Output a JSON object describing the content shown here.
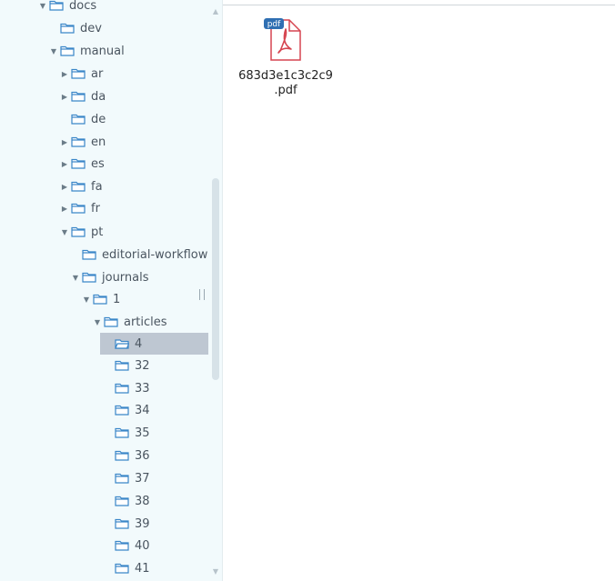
{
  "tree": {
    "items": [
      {
        "label": "docs",
        "expanded": true,
        "has_children": true
      },
      {
        "label": "dev",
        "expanded": false,
        "has_children": false
      },
      {
        "label": "manual",
        "expanded": true,
        "has_children": true
      },
      {
        "label": "ar",
        "expanded": false,
        "has_children": true
      },
      {
        "label": "da",
        "expanded": false,
        "has_children": true
      },
      {
        "label": "de",
        "expanded": false,
        "has_children": false
      },
      {
        "label": "en",
        "expanded": false,
        "has_children": true
      },
      {
        "label": "es",
        "expanded": false,
        "has_children": true
      },
      {
        "label": "fa",
        "expanded": false,
        "has_children": true
      },
      {
        "label": "fr",
        "expanded": false,
        "has_children": true
      },
      {
        "label": "pt",
        "expanded": true,
        "has_children": true
      },
      {
        "label": "editorial-workflow",
        "expanded": false,
        "has_children": false
      },
      {
        "label": "journals",
        "expanded": true,
        "has_children": true
      },
      {
        "label": "1",
        "expanded": true,
        "has_children": true
      },
      {
        "label": "articles",
        "expanded": true,
        "has_children": true
      },
      {
        "label": "4",
        "expanded": false,
        "has_children": false,
        "selected": true
      },
      {
        "label": "32",
        "expanded": false,
        "has_children": false
      },
      {
        "label": "33",
        "expanded": false,
        "has_children": false
      },
      {
        "label": "34",
        "expanded": false,
        "has_children": false
      },
      {
        "label": "35",
        "expanded": false,
        "has_children": false
      },
      {
        "label": "36",
        "expanded": false,
        "has_children": false
      },
      {
        "label": "37",
        "expanded": false,
        "has_children": false
      },
      {
        "label": "38",
        "expanded": false,
        "has_children": false
      },
      {
        "label": "39",
        "expanded": false,
        "has_children": false
      },
      {
        "label": "40",
        "expanded": false,
        "has_children": false
      },
      {
        "label": "41",
        "expanded": false,
        "has_children": false
      }
    ]
  },
  "content": {
    "file": {
      "name": "683d3e1c3c2c9\n.pdf",
      "badge": "pdf",
      "icon": "pdf-file-icon"
    }
  },
  "colors": {
    "sidebar_bg": "#f2fafc",
    "folder_stroke": "#3a86c8",
    "selected_bg": "#bec7d2",
    "pdf_red": "#d64550",
    "pdf_badge_bg": "#2f6fb2"
  }
}
